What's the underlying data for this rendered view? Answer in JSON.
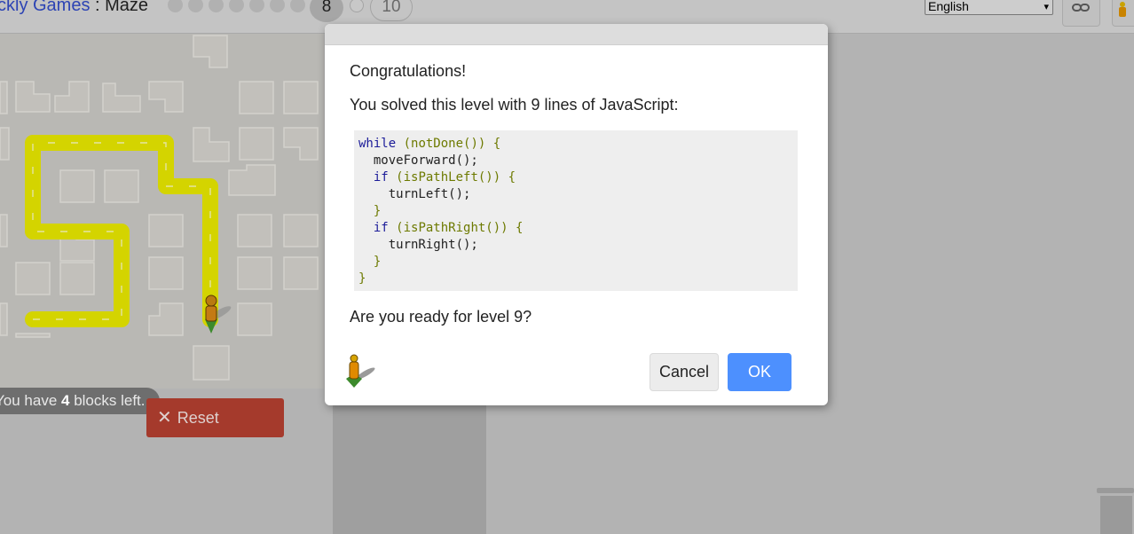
{
  "header": {
    "brand": "ckly Games",
    "separator": " : ",
    "game": "Maze",
    "current_level": "8",
    "last_level": "10",
    "language": "English"
  },
  "maze": {
    "blocks_left_prefix": "You have ",
    "blocks_left_count": "4",
    "blocks_left_suffix": " blocks left.",
    "reset_label": "Reset"
  },
  "dialog": {
    "congrats": "Congratulations!",
    "solved": "You solved this level with 9 lines of JavaScript:",
    "code": {
      "kw_while": "while",
      "cond_while": "(notDone())",
      "open1": "{",
      "l2": "moveForward();",
      "kw_if1": "if",
      "cond_if1": "(isPathLeft())",
      "open2": "{",
      "l4": "turnLeft();",
      "close2": "}",
      "kw_if2": "if",
      "cond_if2": "(isPathRight())",
      "open3": "{",
      "l7": "turnRight();",
      "close3": "}",
      "close1": "}"
    },
    "question": "Are you ready for level 9?",
    "cancel_label": "Cancel",
    "ok_label": "OK"
  },
  "icons": {
    "link": "link-icon",
    "pegman": "pegman-icon",
    "trash": "trash-icon",
    "close": "close-icon",
    "dropdown": "chevron-down-icon"
  },
  "colors": {
    "path": "#d4d400",
    "ok": "#4d90fe",
    "reset": "#a53a2c",
    "overlay": "#b3b3b3"
  }
}
